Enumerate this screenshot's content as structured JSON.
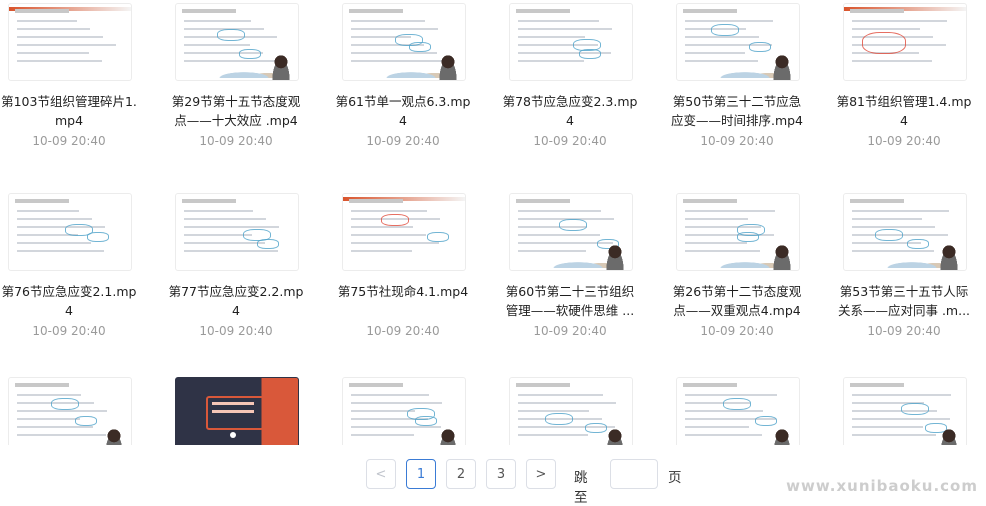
{
  "files": [
    {
      "name": "第103节组织管理碎片1.mp4",
      "time": "10-09 20:40",
      "thumb": "red-header"
    },
    {
      "name": "第29节第十五节态度观点——十大效应 .mp4",
      "time": "10-09 20:40",
      "thumb": "presenter"
    },
    {
      "name": "第61节单一观点6.3.mp4",
      "time": "10-09 20:40",
      "thumb": "presenter"
    },
    {
      "name": "第78节应急应变2.3.mp4",
      "time": "10-09 20:40",
      "thumb": "handwriting"
    },
    {
      "name": "第50节第三十二节应急应变——时间排序.mp4",
      "time": "10-09 20:40",
      "thumb": "presenter"
    },
    {
      "name": "第81节组织管理1.4.mp4",
      "time": "10-09 20:40",
      "thumb": "red-header"
    },
    {
      "name": "第76节应急应变2.1.mp4",
      "time": "10-09 20:40",
      "thumb": "handwriting"
    },
    {
      "name": "第77节应急应变2.2.mp4",
      "time": "10-09 20:40",
      "thumb": "handwriting"
    },
    {
      "name": "第75节社现命4.1.mp4",
      "time": "10-09 20:40",
      "thumb": "red-handwriting"
    },
    {
      "name": "第60节第二十三节组织管理——软硬件思维 ...",
      "time": "10-09 20:40",
      "thumb": "presenter"
    },
    {
      "name": "第26节第十二节态度观点——双重观点4.mp4",
      "time": "10-09 20:40",
      "thumb": "presenter"
    },
    {
      "name": "第53节第三十五节人际关系——应对同事 .m...",
      "time": "10-09 20:40",
      "thumb": "presenter"
    },
    {
      "name": "",
      "time": "",
      "thumb": "presenter"
    },
    {
      "name": "",
      "time": "",
      "thumb": "dark-cover"
    },
    {
      "name": "",
      "time": "",
      "thumb": "presenter"
    },
    {
      "name": "",
      "time": "",
      "thumb": "presenter"
    },
    {
      "name": "",
      "time": "",
      "thumb": "presenter"
    },
    {
      "name": "",
      "time": "",
      "thumb": "presenter"
    }
  ],
  "pagination": {
    "prev": "<",
    "pages": [
      "1",
      "2",
      "3"
    ],
    "current": "1",
    "next": ">",
    "jump_label": "跳至",
    "jump_value": "",
    "page_suffix": "页"
  },
  "watermark": "www.xunibaoku.com"
}
